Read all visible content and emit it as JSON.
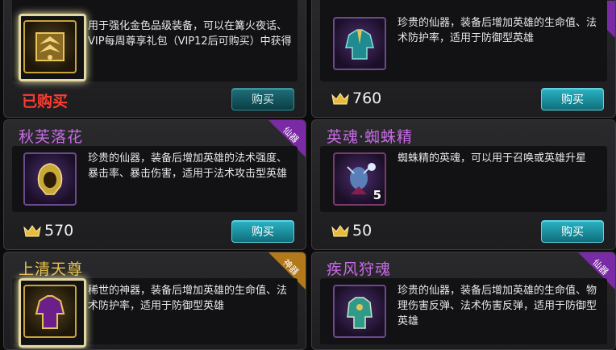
{
  "cards": [
    {
      "title": "",
      "desc": "用于强化金色品级装备，可以在篝火夜话、VIP每周尊享礼包（VIP12后可购买）中获得",
      "status": "已购买",
      "button": "购买",
      "icon": "gold-rank-emblem-icon"
    },
    {
      "title": "",
      "desc": "珍贵的仙器，装备后增加英雄的生命值、法术防护率，适用于防御型英雄",
      "price": "760",
      "button": "购买",
      "icon": "jade-robe-armor-icon"
    },
    {
      "title": "秋芙落花",
      "ribbon": "仙器",
      "desc": "珍贵的仙器，装备后增加英雄的法术强度、暴击率、暴击伤害，适用于法术攻击型英雄",
      "price": "570",
      "button": "购买",
      "icon": "golden-hood-icon"
    },
    {
      "title": "英魂·蜘蛛精",
      "desc": "蜘蛛精的英魂，可以用于召唤或英雄升星",
      "price": "50",
      "count": "5",
      "button": "购买",
      "icon": "spider-spirit-portrait-icon"
    },
    {
      "title": "上清天尊",
      "ribbon": "神器",
      "desc": "稀世的神器，装备后增加英雄的生命值、法术防护率，适用于防御型英雄",
      "icon": "purple-gold-robe-icon"
    },
    {
      "title": "疾风狩魂",
      "ribbon": "仙器",
      "desc": "珍贵的仙器，装备后增加英雄的生命值、物理伤害反弹、法术伤害反弹，适用于防御型英雄",
      "icon": "teal-armor-icon"
    }
  ],
  "colors": {
    "title_purple": "#c96ae6",
    "title_gold": "#e9c24a",
    "ribbon_purple": "#7b2aa6",
    "ribbon_gold": "#b2781a",
    "bought_red": "#ff3b30",
    "button_teal": "#2bb3c4"
  }
}
